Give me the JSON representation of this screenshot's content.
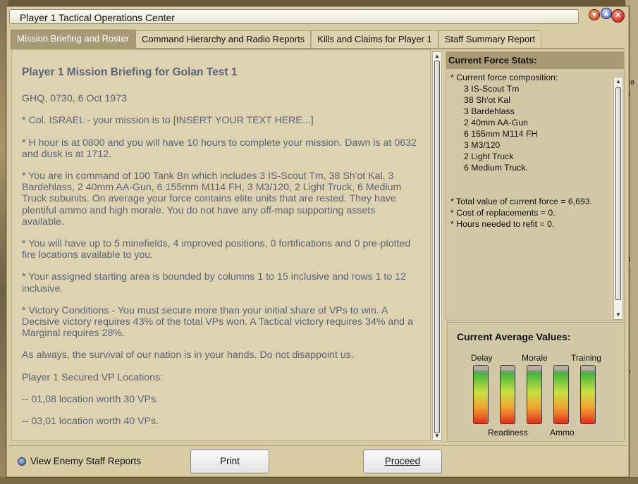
{
  "window": {
    "title": "Player 1 Tactical Operations Center"
  },
  "background": {
    "edge_text": [
      "r",
      "38",
      "3",
      "H",
      "F",
      "4",
      "u"
    ]
  },
  "tabs": [
    {
      "label": "Mission Briefing and Roster",
      "active": true
    },
    {
      "label": "Command Hierarchy and Radio Reports",
      "active": false
    },
    {
      "label": "Kills and Claims for Player 1",
      "active": false
    },
    {
      "label": "Staff Summary Report",
      "active": false
    }
  ],
  "briefing": {
    "title": "Player 1 Mission Briefing for Golan Test 1",
    "paragraphs": [
      "GHQ, 0730, 6 Oct 1973",
      "* Col. ISRAEL - your mission is to [INSERT YOUR TEXT HERE...]",
      "* H hour is at 0800 and you will have 10 hours to complete your mission. Dawn is at 0632 and dusk is at 1712.",
      "* You are in command of 100 Tank Bn which includes 3 IS-Scout Tm, 38 Sh'ot Kal, 3 Bardehlass, 2 40mm AA-Gun, 6 155mm M114 FH, 3 M3/120, 2 Light Truck, 6 Medium Truck subunits. On average your force contains elite units that are rested. They have plentiful ammo and high morale. You do not have any off-map supporting assets available.",
      "* You will have up to 5 minefields, 4 improved positions, 0 fortifications and 0 pre-plotted fire locations available to you.",
      "* Your assigned starting area is bounded by columns 1 to 15 inclusive and rows 1 to 12 inclusive.",
      "* Victory Conditions - You must secure more than your initial share of VPs to win. A Decisive victory requires 43% of the total VPs won. A Tactical victory requires 34% and a Marginal requires 28%.",
      "As always, the survival of our nation is in your hands. Do not disappoint us.",
      "Player 1 Secured VP Locations:",
      "-- 01,08 location worth 30 VPs.",
      "-- 03,01 location worth 40 VPs."
    ]
  },
  "force_stats": {
    "header": "Current Force Stats:",
    "composition_label": "* Current force composition:",
    "units": [
      "3 IS-Scout Tm",
      "38 Sh'ot Kal",
      "3 Bardehlass",
      "2 40mm AA-Gun",
      "6 155mm M114 FH",
      "3 M3/120",
      "2 Light Truck",
      "6 Medium Truck."
    ],
    "totals": [
      "* Total value of current force = 6,693.",
      "* Cost of replacements = 0.",
      "* Hours needed to refit = 0."
    ]
  },
  "averages": {
    "title": "Current Average Values:",
    "top_labels": [
      "Delay",
      "Morale",
      "Training"
    ],
    "bottom_labels": [
      "Readiness",
      "Ammo"
    ],
    "gauges": [
      "Delay",
      "Readiness",
      "Morale",
      "Ammo",
      "Training"
    ]
  },
  "footer": {
    "view_enemy_label": "View Enemy Staff Reports",
    "print_label": "Print",
    "proceed_label": "Proceed"
  }
}
